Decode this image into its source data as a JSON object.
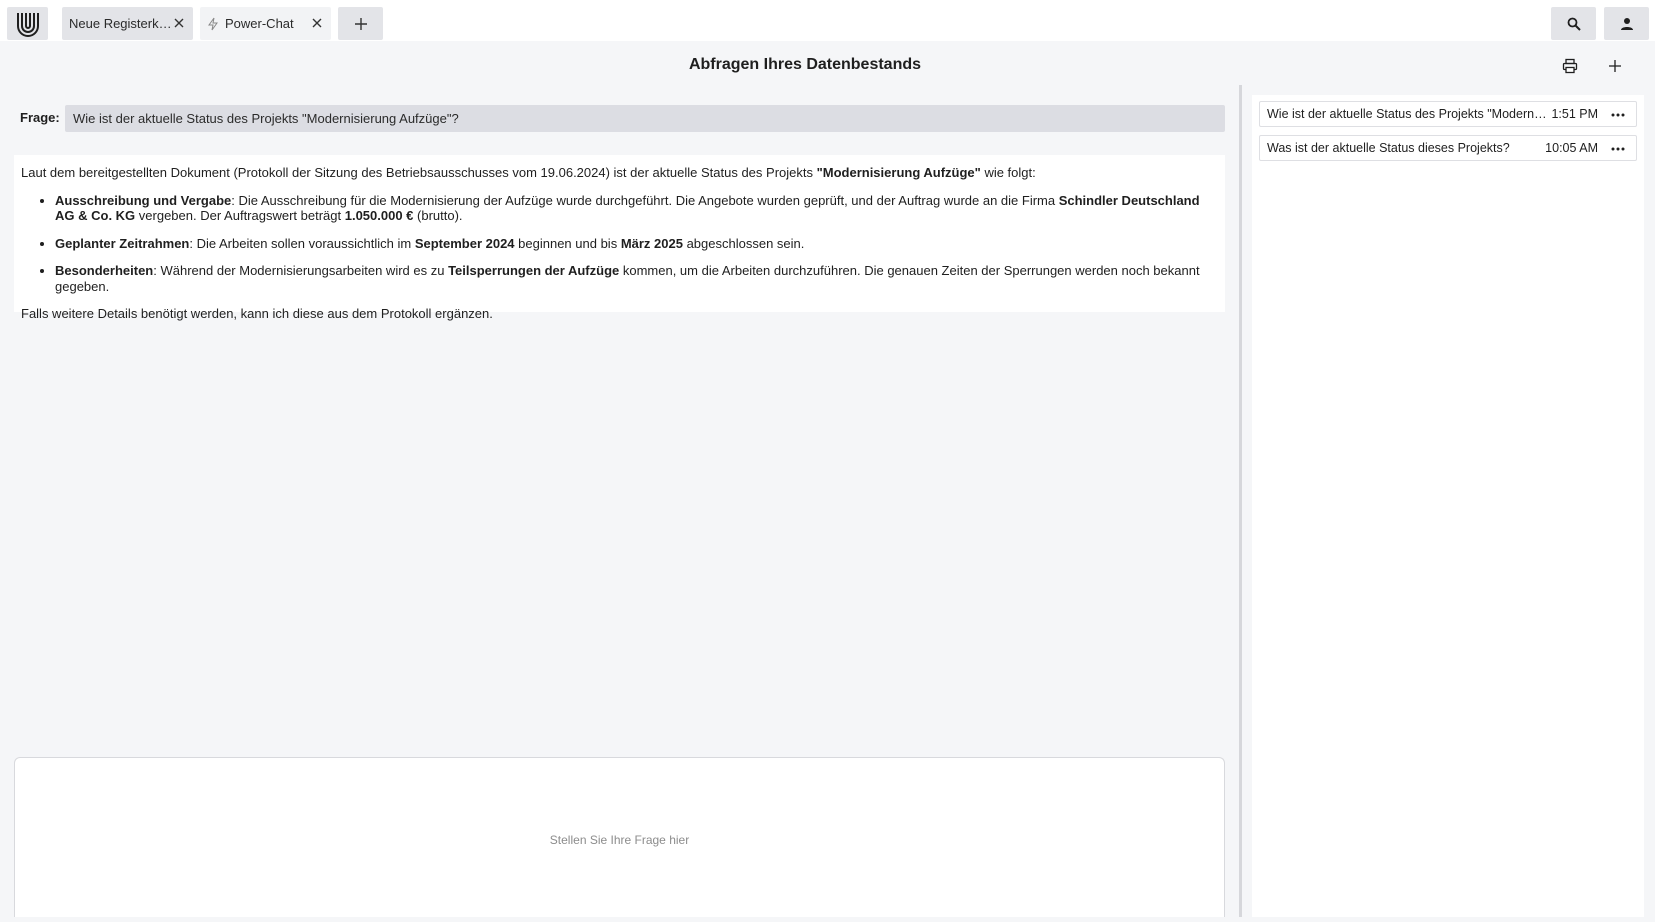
{
  "tabs": [
    {
      "label": "Neue Registerkarte"
    },
    {
      "label": "Power-Chat"
    }
  ],
  "header": {
    "title": "Abfragen Ihres Datenbestands"
  },
  "question": {
    "label": "Frage:",
    "value": "Wie ist der aktuelle Status des Projekts \"Modernisierung Aufzüge\"?"
  },
  "answer": {
    "intro_1": "Laut dem bereitgestellten Dokument (Protokoll der Sitzung des Betriebsausschusses vom 19.06.2024) ist der aktuelle Status des Projekts ",
    "intro_project": "\"Modernisierung Aufzüge\"",
    "intro_2": " wie folgt:",
    "bullets": [
      {
        "head": "Ausschreibung und Vergabe",
        "t1": ": Die Ausschreibung für die Modernisierung der Aufzüge wurde durchgeführt. Die Angebote wurden geprüft, und der Auftrag wurde an die Firma ",
        "b1": "Schindler Deutschland AG & Co. KG",
        "t2": " vergeben. Der Auftragswert beträgt ",
        "b2": "1.050.000 €",
        "t3": " (brutto)."
      },
      {
        "head": "Geplanter Zeitrahmen",
        "t1": ": Die Arbeiten sollen voraussichtlich im ",
        "b1": "September 2024",
        "t2": " beginnen und bis ",
        "b2": "März 2025",
        "t3": " abgeschlossen sein."
      },
      {
        "head": "Besonderheiten",
        "t1": ": Während der Modernisierungsarbeiten wird es zu ",
        "b1": "Teilsperrungen der Aufzüge",
        "t2": " kommen, um die Arbeiten durchzuführen. Die genauen Zeiten der Sperrungen werden noch bekannt gegeben."
      }
    ],
    "outro": "Falls weitere Details benötigt werden, kann ich diese aus dem Protokoll ergänzen."
  },
  "prompt": {
    "placeholder": "Stellen Sie Ihre Frage hier"
  },
  "history": [
    {
      "text": "Wie ist der aktuelle Status des Projekts \"Modernisierung Aufzüge\"?",
      "time": "1:51 PM"
    },
    {
      "text": "Was ist der aktuelle Status dieses Projekts?",
      "time": "10:05 AM"
    }
  ],
  "colors": {
    "background": "#f5f6f8",
    "tab_active": "#e3e4e8",
    "question_field": "#dcdde3",
    "surface": "#ffffff"
  }
}
